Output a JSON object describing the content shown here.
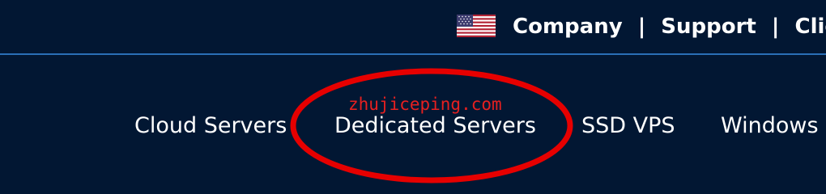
{
  "header": {
    "flag_icon": "us-flag-icon",
    "links": [
      {
        "label": "Company"
      },
      {
        "label": "Support"
      },
      {
        "label": "Clien"
      }
    ],
    "separator": "|"
  },
  "nav": {
    "items": [
      {
        "label": "Cloud Servers"
      },
      {
        "label": "Dedicated Servers"
      },
      {
        "label": "SSD VPS"
      },
      {
        "label": "Windows"
      }
    ]
  },
  "annotation": {
    "watermark_text": "zhujiceping.com",
    "highlight_color": "#e60000"
  },
  "colors": {
    "background": "#021733",
    "divider": "#2a6fb7",
    "text": "#ffffff"
  }
}
